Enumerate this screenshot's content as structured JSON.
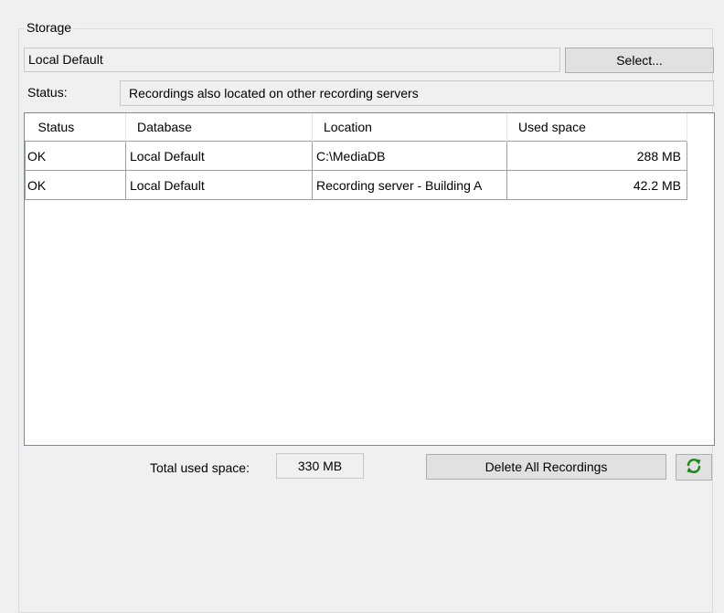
{
  "storage": {
    "group_label": "Storage",
    "name": "Local Default",
    "select_label": "Select...",
    "status_label": "Status:",
    "status_value": "Recordings also located on other recording servers"
  },
  "table": {
    "columns": [
      "Status",
      "Database",
      "Location",
      "Used space"
    ],
    "rows": [
      [
        "OK",
        "Local Default",
        "C:\\MediaDB",
        "288 MB"
      ],
      [
        "OK",
        "Local Default",
        "Recording server - Building A",
        "42.2 MB"
      ]
    ]
  },
  "footer": {
    "total_label": "Total used space:",
    "total_value": "330 MB",
    "delete_label": "Delete All Recordings",
    "refresh_icon": "refresh-icon",
    "icon_color": "#1e8a1e"
  }
}
